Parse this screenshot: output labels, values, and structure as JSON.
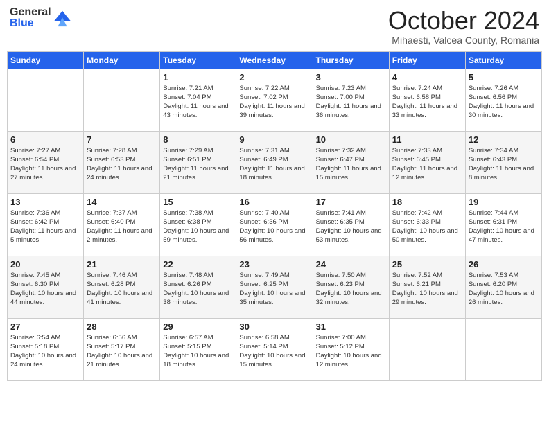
{
  "header": {
    "logo_general": "General",
    "logo_blue": "Blue",
    "month_title": "October 2024",
    "location": "Mihaesti, Valcea County, Romania"
  },
  "days_of_week": [
    "Sunday",
    "Monday",
    "Tuesday",
    "Wednesday",
    "Thursday",
    "Friday",
    "Saturday"
  ],
  "weeks": [
    [
      {
        "day": "",
        "sunrise": "",
        "sunset": "",
        "daylight": ""
      },
      {
        "day": "",
        "sunrise": "",
        "sunset": "",
        "daylight": ""
      },
      {
        "day": "1",
        "sunrise": "Sunrise: 7:21 AM",
        "sunset": "Sunset: 7:04 PM",
        "daylight": "Daylight: 11 hours and 43 minutes."
      },
      {
        "day": "2",
        "sunrise": "Sunrise: 7:22 AM",
        "sunset": "Sunset: 7:02 PM",
        "daylight": "Daylight: 11 hours and 39 minutes."
      },
      {
        "day": "3",
        "sunrise": "Sunrise: 7:23 AM",
        "sunset": "Sunset: 7:00 PM",
        "daylight": "Daylight: 11 hours and 36 minutes."
      },
      {
        "day": "4",
        "sunrise": "Sunrise: 7:24 AM",
        "sunset": "Sunset: 6:58 PM",
        "daylight": "Daylight: 11 hours and 33 minutes."
      },
      {
        "day": "5",
        "sunrise": "Sunrise: 7:26 AM",
        "sunset": "Sunset: 6:56 PM",
        "daylight": "Daylight: 11 hours and 30 minutes."
      }
    ],
    [
      {
        "day": "6",
        "sunrise": "Sunrise: 7:27 AM",
        "sunset": "Sunset: 6:54 PM",
        "daylight": "Daylight: 11 hours and 27 minutes."
      },
      {
        "day": "7",
        "sunrise": "Sunrise: 7:28 AM",
        "sunset": "Sunset: 6:53 PM",
        "daylight": "Daylight: 11 hours and 24 minutes."
      },
      {
        "day": "8",
        "sunrise": "Sunrise: 7:29 AM",
        "sunset": "Sunset: 6:51 PM",
        "daylight": "Daylight: 11 hours and 21 minutes."
      },
      {
        "day": "9",
        "sunrise": "Sunrise: 7:31 AM",
        "sunset": "Sunset: 6:49 PM",
        "daylight": "Daylight: 11 hours and 18 minutes."
      },
      {
        "day": "10",
        "sunrise": "Sunrise: 7:32 AM",
        "sunset": "Sunset: 6:47 PM",
        "daylight": "Daylight: 11 hours and 15 minutes."
      },
      {
        "day": "11",
        "sunrise": "Sunrise: 7:33 AM",
        "sunset": "Sunset: 6:45 PM",
        "daylight": "Daylight: 11 hours and 12 minutes."
      },
      {
        "day": "12",
        "sunrise": "Sunrise: 7:34 AM",
        "sunset": "Sunset: 6:43 PM",
        "daylight": "Daylight: 11 hours and 8 minutes."
      }
    ],
    [
      {
        "day": "13",
        "sunrise": "Sunrise: 7:36 AM",
        "sunset": "Sunset: 6:42 PM",
        "daylight": "Daylight: 11 hours and 5 minutes."
      },
      {
        "day": "14",
        "sunrise": "Sunrise: 7:37 AM",
        "sunset": "Sunset: 6:40 PM",
        "daylight": "Daylight: 11 hours and 2 minutes."
      },
      {
        "day": "15",
        "sunrise": "Sunrise: 7:38 AM",
        "sunset": "Sunset: 6:38 PM",
        "daylight": "Daylight: 10 hours and 59 minutes."
      },
      {
        "day": "16",
        "sunrise": "Sunrise: 7:40 AM",
        "sunset": "Sunset: 6:36 PM",
        "daylight": "Daylight: 10 hours and 56 minutes."
      },
      {
        "day": "17",
        "sunrise": "Sunrise: 7:41 AM",
        "sunset": "Sunset: 6:35 PM",
        "daylight": "Daylight: 10 hours and 53 minutes."
      },
      {
        "day": "18",
        "sunrise": "Sunrise: 7:42 AM",
        "sunset": "Sunset: 6:33 PM",
        "daylight": "Daylight: 10 hours and 50 minutes."
      },
      {
        "day": "19",
        "sunrise": "Sunrise: 7:44 AM",
        "sunset": "Sunset: 6:31 PM",
        "daylight": "Daylight: 10 hours and 47 minutes."
      }
    ],
    [
      {
        "day": "20",
        "sunrise": "Sunrise: 7:45 AM",
        "sunset": "Sunset: 6:30 PM",
        "daylight": "Daylight: 10 hours and 44 minutes."
      },
      {
        "day": "21",
        "sunrise": "Sunrise: 7:46 AM",
        "sunset": "Sunset: 6:28 PM",
        "daylight": "Daylight: 10 hours and 41 minutes."
      },
      {
        "day": "22",
        "sunrise": "Sunrise: 7:48 AM",
        "sunset": "Sunset: 6:26 PM",
        "daylight": "Daylight: 10 hours and 38 minutes."
      },
      {
        "day": "23",
        "sunrise": "Sunrise: 7:49 AM",
        "sunset": "Sunset: 6:25 PM",
        "daylight": "Daylight: 10 hours and 35 minutes."
      },
      {
        "day": "24",
        "sunrise": "Sunrise: 7:50 AM",
        "sunset": "Sunset: 6:23 PM",
        "daylight": "Daylight: 10 hours and 32 minutes."
      },
      {
        "day": "25",
        "sunrise": "Sunrise: 7:52 AM",
        "sunset": "Sunset: 6:21 PM",
        "daylight": "Daylight: 10 hours and 29 minutes."
      },
      {
        "day": "26",
        "sunrise": "Sunrise: 7:53 AM",
        "sunset": "Sunset: 6:20 PM",
        "daylight": "Daylight: 10 hours and 26 minutes."
      }
    ],
    [
      {
        "day": "27",
        "sunrise": "Sunrise: 6:54 AM",
        "sunset": "Sunset: 5:18 PM",
        "daylight": "Daylight: 10 hours and 24 minutes."
      },
      {
        "day": "28",
        "sunrise": "Sunrise: 6:56 AM",
        "sunset": "Sunset: 5:17 PM",
        "daylight": "Daylight: 10 hours and 21 minutes."
      },
      {
        "day": "29",
        "sunrise": "Sunrise: 6:57 AM",
        "sunset": "Sunset: 5:15 PM",
        "daylight": "Daylight: 10 hours and 18 minutes."
      },
      {
        "day": "30",
        "sunrise": "Sunrise: 6:58 AM",
        "sunset": "Sunset: 5:14 PM",
        "daylight": "Daylight: 10 hours and 15 minutes."
      },
      {
        "day": "31",
        "sunrise": "Sunrise: 7:00 AM",
        "sunset": "Sunset: 5:12 PM",
        "daylight": "Daylight: 10 hours and 12 minutes."
      },
      {
        "day": "",
        "sunrise": "",
        "sunset": "",
        "daylight": ""
      },
      {
        "day": "",
        "sunrise": "",
        "sunset": "",
        "daylight": ""
      }
    ]
  ]
}
